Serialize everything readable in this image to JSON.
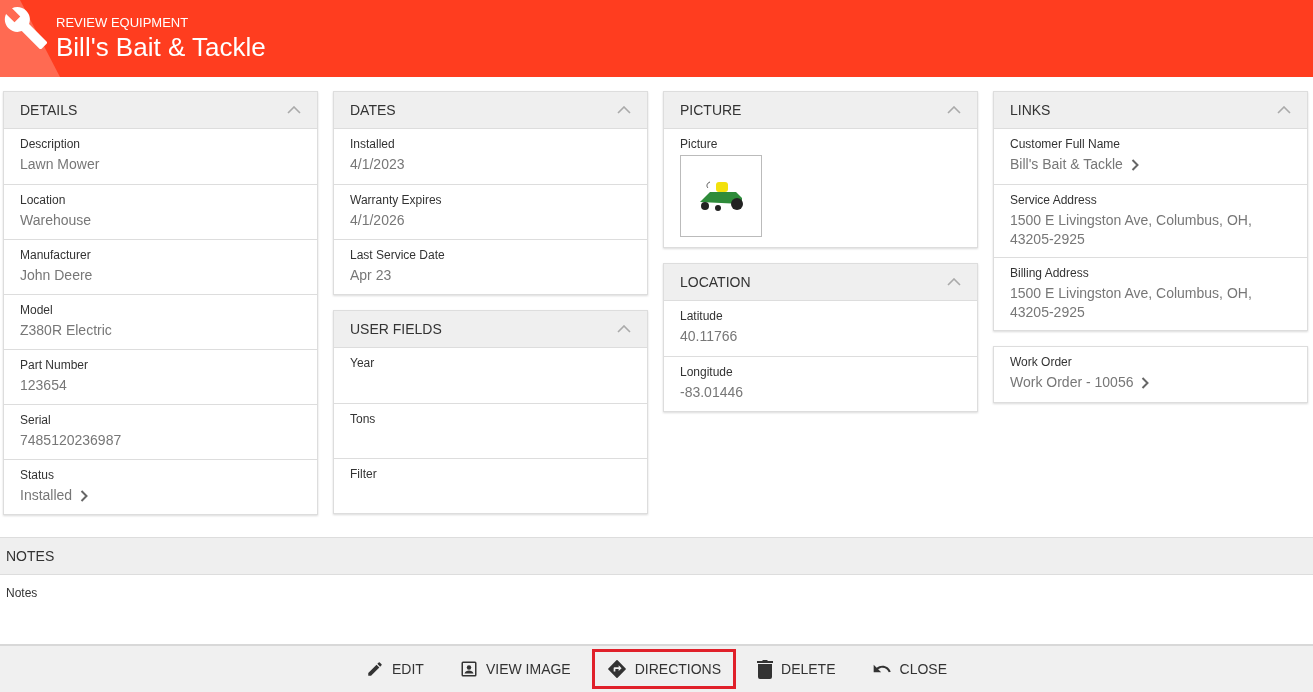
{
  "header": {
    "subtitle": "REVIEW EQUIPMENT",
    "title": "Bill's Bait & Tackle"
  },
  "columns": [
    [
      {
        "title": "DETAILS",
        "expanded": true,
        "fields": [
          {
            "kind": "text",
            "label": "Description",
            "value": "Lawn Mower"
          },
          {
            "kind": "text",
            "label": "Location",
            "value": "Warehouse"
          },
          {
            "kind": "text",
            "label": "Manufacturer",
            "value": "John Deere"
          },
          {
            "kind": "text",
            "label": "Model",
            "value": "Z380R Electric"
          },
          {
            "kind": "text",
            "label": "Part Number",
            "value": "123654"
          },
          {
            "kind": "text",
            "label": "Serial",
            "value": "7485120236987"
          },
          {
            "kind": "link",
            "label": "Status",
            "value": "Installed"
          }
        ]
      }
    ],
    [
      {
        "title": "DATES",
        "expanded": true,
        "fields": [
          {
            "kind": "text",
            "label": "Installed",
            "value": "4/1/2023"
          },
          {
            "kind": "text",
            "label": "Warranty Expires",
            "value": "4/1/2026"
          },
          {
            "kind": "text",
            "label": "Last Service Date",
            "value": "Apr 23"
          }
        ]
      },
      {
        "title": "USER FIELDS",
        "expanded": true,
        "fields": [
          {
            "kind": "text",
            "label": "Year"
          },
          {
            "kind": "text",
            "label": "Tons"
          },
          {
            "kind": "text",
            "label": "Filter"
          }
        ]
      }
    ],
    [
      {
        "title": "PICTURE",
        "expanded": true,
        "fields": [
          {
            "kind": "image",
            "label": "Picture"
          }
        ]
      },
      {
        "title": "LOCATION",
        "expanded": true,
        "fields": [
          {
            "kind": "text",
            "label": "Latitude",
            "value": "40.11766"
          },
          {
            "kind": "text",
            "label": "Longitude",
            "value": "-83.01446"
          }
        ]
      }
    ],
    [
      {
        "title": "LINKS",
        "expanded": true,
        "fields": [
          {
            "kind": "link",
            "label": "Customer Full Name",
            "value": "Bill's Bait & Tackle"
          },
          {
            "kind": "text",
            "label": "Service Address",
            "value": "1500 E Livingston Ave, Columbus, OH, 43205-2925"
          },
          {
            "kind": "text",
            "label": "Billing Address",
            "value": "1500 E Livingston Ave, Columbus, OH, 43205-2925"
          }
        ]
      },
      {
        "fields": [
          {
            "kind": "link",
            "label": "Work Order",
            "value": "Work Order - 10056"
          }
        ]
      }
    ]
  ],
  "notes": {
    "title": "NOTES",
    "label": "Notes"
  },
  "toolbar": [
    {
      "kind": "edit",
      "label": "EDIT",
      "selected": false
    },
    {
      "kind": "image",
      "label": "VIEW IMAGE",
      "selected": false
    },
    {
      "kind": "directions",
      "label": "DIRECTIONS",
      "selected": true
    },
    {
      "kind": "delete",
      "label": "DELETE",
      "selected": false
    },
    {
      "kind": "close",
      "label": "CLOSE",
      "selected": false
    }
  ]
}
